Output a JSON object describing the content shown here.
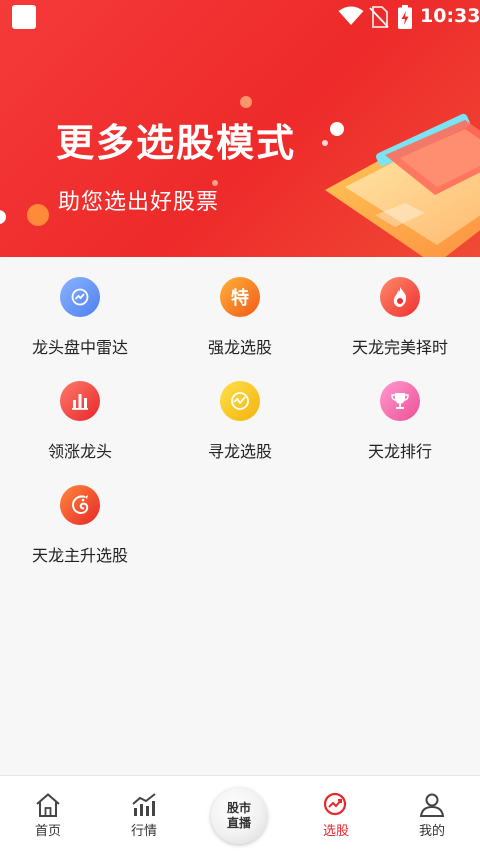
{
  "status_bar": {
    "time": "10:33"
  },
  "banner": {
    "title": "更多选股模式",
    "subtitle": "助您选出好股票"
  },
  "tools": [
    {
      "label": "龙头盘中雷达",
      "icon": "radar-icon",
      "color": "#5b8cf0"
    },
    {
      "label": "强龙选股",
      "icon": "te-badge-icon",
      "color": "#f46a1f",
      "icon_text": "特"
    },
    {
      "label": "天龙完美择时",
      "icon": "flame-icon",
      "color": "#f24b3a"
    },
    {
      "label": "领涨龙头",
      "icon": "bar-chart-icon",
      "color": "#ef3a3a"
    },
    {
      "label": "寻龙选股",
      "icon": "trend-search-icon",
      "color": "#f6c21b"
    },
    {
      "label": "天龙排行",
      "icon": "trophy-icon",
      "color": "#f25fa0"
    },
    {
      "label": "天龙主升选股",
      "icon": "dragon-icon",
      "color": "#f24a28"
    }
  ],
  "bottom_nav": {
    "home": "首页",
    "market": "行情",
    "live_line1": "股市",
    "live_line2": "直播",
    "picker": "选股",
    "mine": "我的"
  },
  "colors": {
    "accent": "#e8262b",
    "banner": "#f23636"
  }
}
